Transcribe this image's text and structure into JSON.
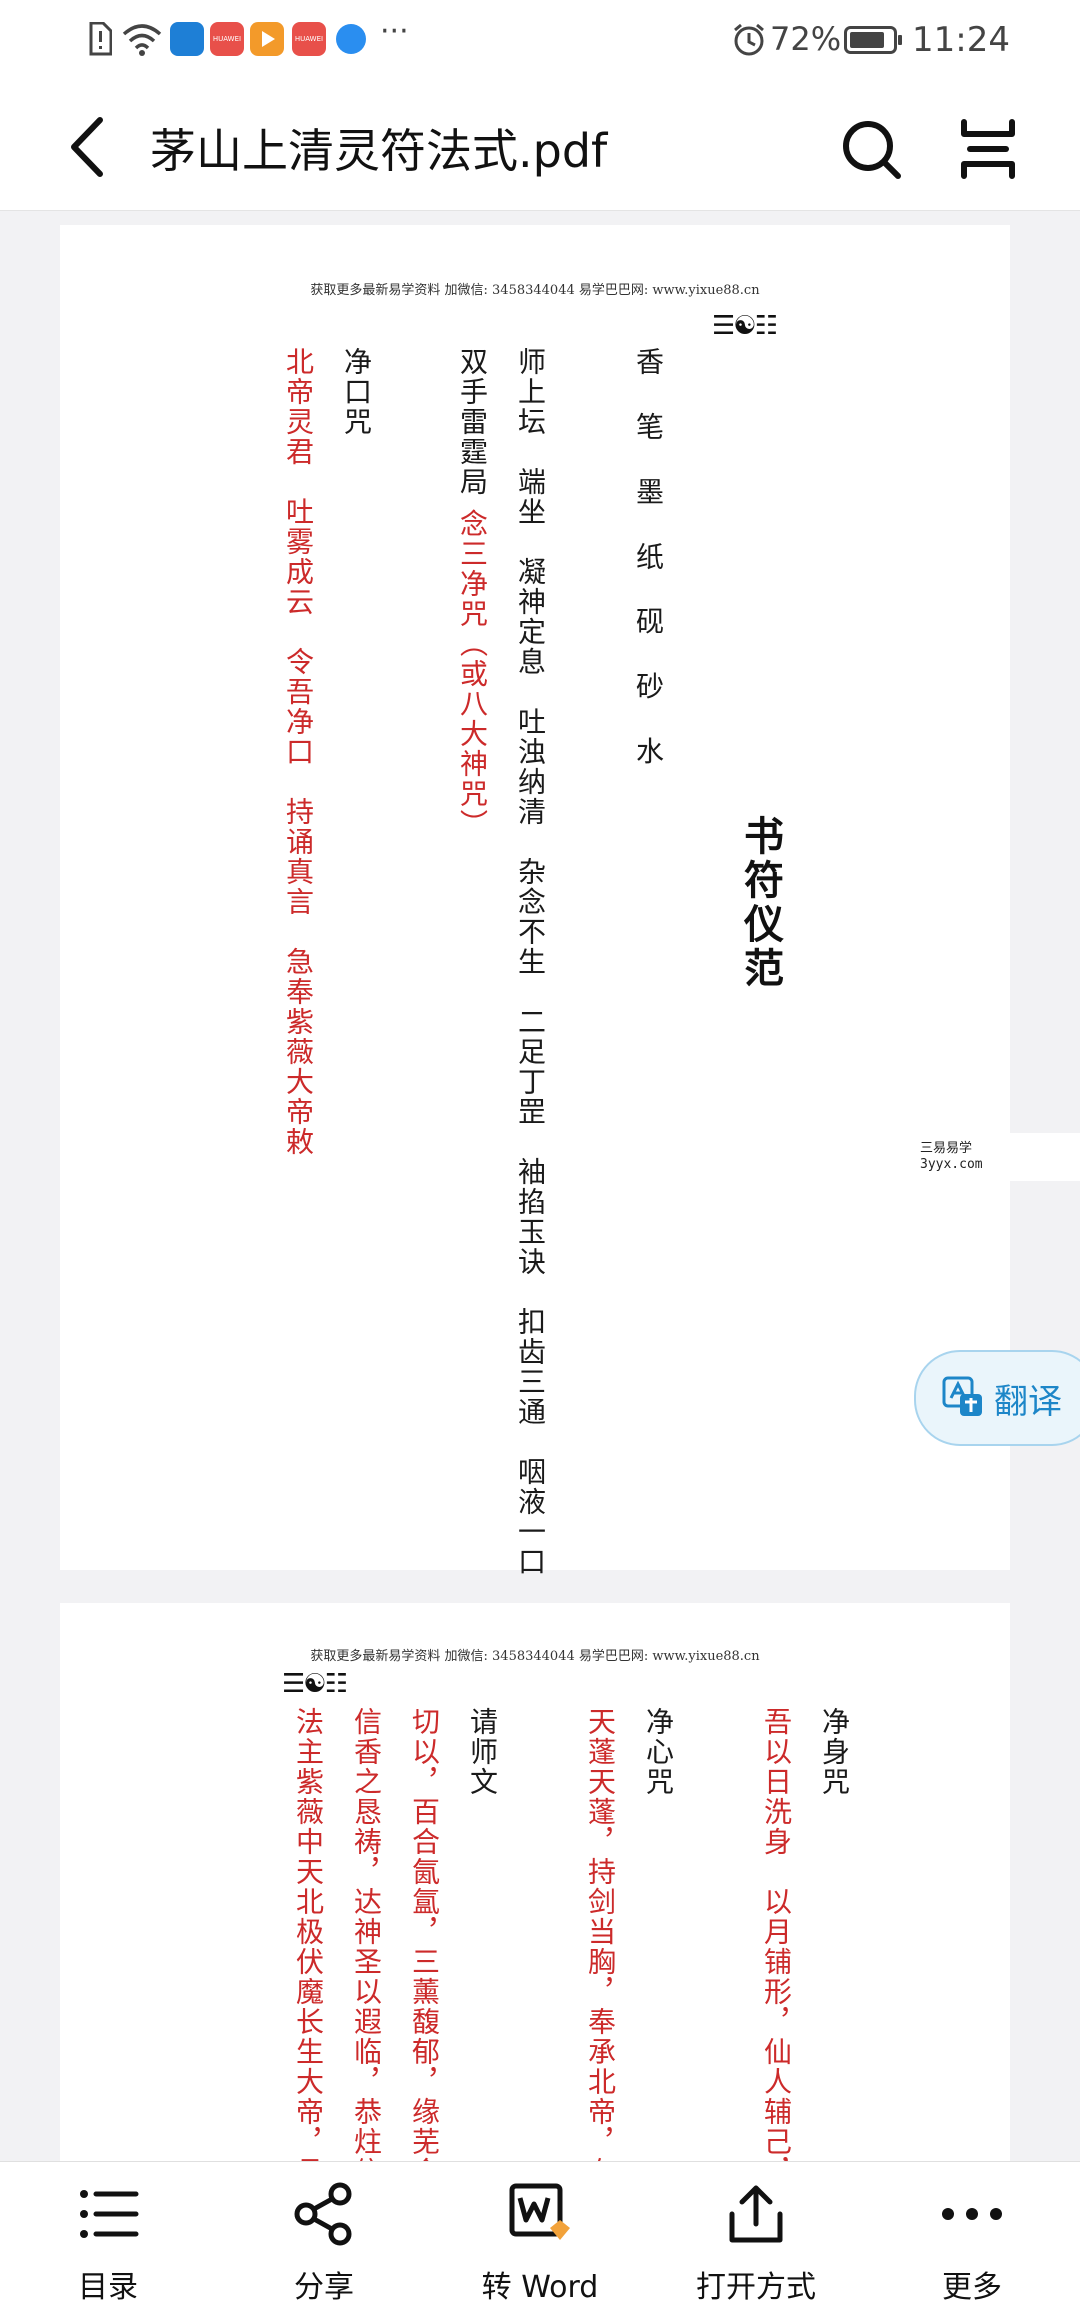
{
  "status_bar": {
    "battery_percent": "72%",
    "time": "11:24",
    "app_badge_1": "HUAWEI",
    "app_badge_2": "HUAWEI",
    "more": "···"
  },
  "app_bar": {
    "title": "茅山上清灵符法式.pdf"
  },
  "document": {
    "page1": {
      "header_note": "获取更多最新易学资料 加微信: 3458344044 易学巴巴网: www.yixue88.cn",
      "trigram": "☰☯☷",
      "heading": "书符仪范",
      "col_items": "香 笔 墨 纸 砚 砂 水",
      "col_ritual": "师上坛　端坐　凝神定息　吐浊纳清　杂念不生　二足丁罡　袖掐玉诀　扣齿三通　咽液一口",
      "col_double": "双手雷霆局",
      "col_chant": "念三净咒（或八大神咒）",
      "col_kouzhou": "净口咒",
      "col_kouzhou_text": "北帝灵君　吐雾成云　令吾净口　持诵真言　急奉紫薇大帝敕"
    },
    "watermark": {
      "line1": "三易易学",
      "line2": "3yyx.com"
    },
    "page2": {
      "header_note": "获取更多最新易学资料 加微信: 3458344044 易学巴巴网: www.yixue88.cn",
      "trigram": "☰☯☷",
      "col_shenzhou": "净身咒",
      "col_shenzhou_text": "吾以日洗身　以月铺形，仙人辅己，玉",
      "col_xinzhou": "净心咒",
      "col_xinzhou_text": "天蓬天蓬，持剑当胸，奉承北帝，有大",
      "col_qingshi": "请师文",
      "col_qingshi_text1": "切以，百合氤氲，三薰馥郁，缘芜金炉",
      "col_qingshi_text2": "信香之恳祷，达神圣以遐临，恭炷信香",
      "col_qingshi_text3": "法主紫薇中天北极伏魔长生大帝，承天"
    }
  },
  "translate_button": {
    "label": "翻译"
  },
  "bottom_bar": {
    "items": [
      {
        "label": "目录",
        "icon": "list-icon"
      },
      {
        "label": "分享",
        "icon": "share-icon"
      },
      {
        "label": "转 Word",
        "icon": "convert-word-icon"
      },
      {
        "label": "打开方式",
        "icon": "open-with-icon"
      },
      {
        "label": "更多",
        "icon": "more-icon"
      }
    ]
  },
  "colors": {
    "red_text": "#cc2a2a",
    "accent_blue": "#1d86c8"
  }
}
